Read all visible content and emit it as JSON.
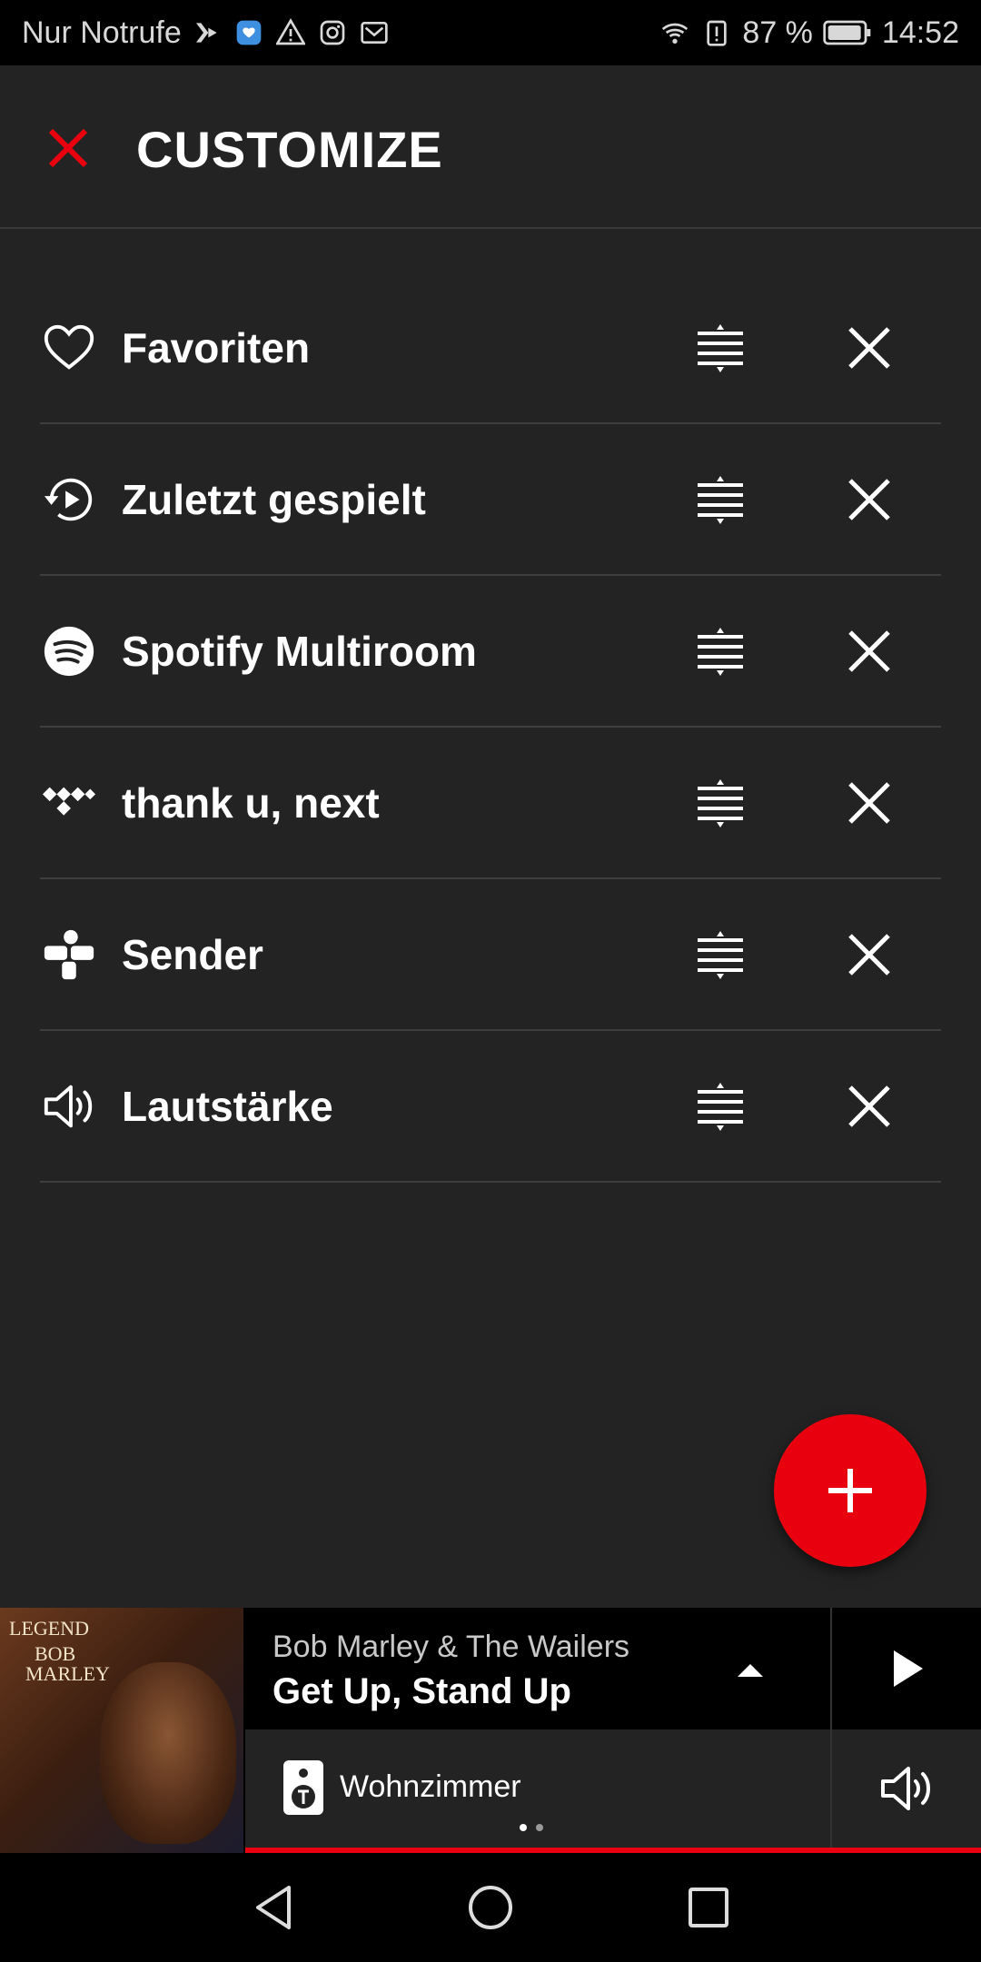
{
  "status_bar": {
    "carrier": "Nur Notrufe",
    "battery": "87 %",
    "time": "14:52",
    "notification_icons": [
      "media-icon",
      "app-badge-icon",
      "warning-icon",
      "instagram-icon",
      "mail-icon"
    ],
    "right_icons": [
      "wifi-icon",
      "battery-alert-icon",
      "battery-icon"
    ]
  },
  "header": {
    "title": "CUSTOMIZE",
    "close_icon": "close-icon",
    "accent": "#e8000f"
  },
  "items": [
    {
      "label": "Favoriten",
      "icon": "heart-icon"
    },
    {
      "label": "Zuletzt gespielt",
      "icon": "recent-play-icon"
    },
    {
      "label": "Spotify Multiroom",
      "icon": "spotify-icon"
    },
    {
      "label": "thank u, next",
      "icon": "tidal-icon"
    },
    {
      "label": "Sender",
      "icon": "tunein-icon"
    },
    {
      "label": "Lautstärke",
      "icon": "volume-icon"
    }
  ],
  "fab": {
    "icon": "add-icon",
    "color": "#e8000f"
  },
  "now_playing": {
    "artist": "Bob Marley & The Wailers",
    "track": "Get Up, Stand Up",
    "room": "Wohnzimmer",
    "album_cover_text": [
      "LEGEND",
      "BOB",
      "MARLEY"
    ],
    "pager": {
      "count": 2,
      "active": 1
    }
  },
  "nav": {
    "back": "back-icon",
    "home": "home-icon",
    "recents": "recents-icon"
  }
}
